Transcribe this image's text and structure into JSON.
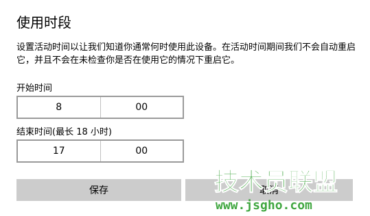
{
  "dialog": {
    "title": "使用时段",
    "description": "设置活动时间以让我们知道你通常何时使用此设备。在活动时间期间我们不会自动重启它，并且不会在未检查你是否在使用它的情况下重启它。"
  },
  "start": {
    "label": "开始时间",
    "hour": "8",
    "minute": "00"
  },
  "end": {
    "label": "结束时间(最长 18 小时)",
    "hour": "17",
    "minute": "00"
  },
  "buttons": {
    "save": "保存",
    "cancel": "取消"
  },
  "watermark": {
    "brand": "技术员联盟",
    "url": "www.jsgho.com",
    "color": "#2f9e2f"
  },
  "colors": {
    "button_bg": "#cccccc",
    "picker_border": "#999999"
  }
}
